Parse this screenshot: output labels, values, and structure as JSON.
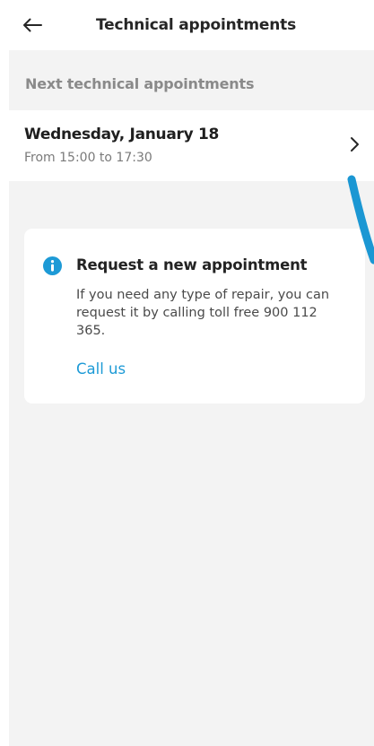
{
  "header": {
    "title": "Technical appointments",
    "back_icon": "arrow-left-icon"
  },
  "section": {
    "title": "Next technical appointments"
  },
  "appointment": {
    "date": "Wednesday, January 18",
    "time": "From 15:00 to 17:30",
    "chevron_icon": "chevron-right-icon"
  },
  "info_card": {
    "icon": "info-icon",
    "title": "Request a new appointment",
    "text": "If you need any type of repair, you can request it by calling toll free 900 112 365.",
    "link": "Call us"
  },
  "colors": {
    "background": "#f3f3f3",
    "accent": "#1d9ad6",
    "title_text": "#262626",
    "secondary_text": "#8a8a8a"
  }
}
